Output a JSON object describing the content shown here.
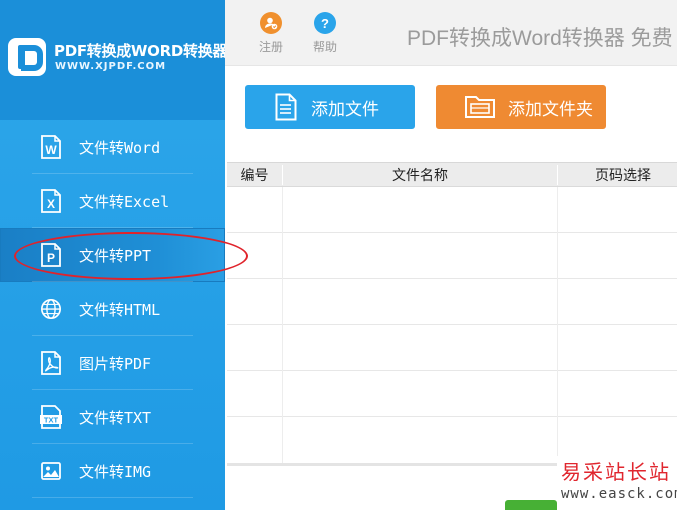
{
  "brand": {
    "title": "PDF转换成WORD转换器",
    "url": "WWW.XJPDF.COM"
  },
  "sidebar": {
    "items": [
      {
        "label": "文件转Word",
        "icon": "word-doc-icon"
      },
      {
        "label": "文件转Excel",
        "icon": "excel-doc-icon"
      },
      {
        "label": "文件转PPT",
        "icon": "ppt-doc-icon",
        "active": true
      },
      {
        "label": "文件转HTML",
        "icon": "globe-icon"
      },
      {
        "label": "图片转PDF",
        "icon": "pdf-doc-icon"
      },
      {
        "label": "文件转TXT",
        "icon": "txt-doc-icon"
      },
      {
        "label": "文件转IMG",
        "icon": "image-icon"
      }
    ]
  },
  "toolbar": {
    "register_label": "注册",
    "help_label": "帮助",
    "help_glyph": "?",
    "app_title": "PDF转换成Word转换器 免费"
  },
  "actions": {
    "add_file_label": "添加文件",
    "add_folder_label": "添加文件夹"
  },
  "table": {
    "columns": [
      "编号",
      "文件名称",
      "页码选择"
    ],
    "rows": []
  },
  "watermark": {
    "title": "易采站长站",
    "url": "www.easck.com"
  },
  "colors": {
    "sidebar_bg": "#2ea7ea",
    "brand_bg": "#1b8fd9",
    "add_file_button": "#2aa4ea",
    "add_folder_button": "#ef8a32",
    "highlight": "#e0232b",
    "register_icon": "#f0902e",
    "help_icon": "#2aa4ea"
  }
}
